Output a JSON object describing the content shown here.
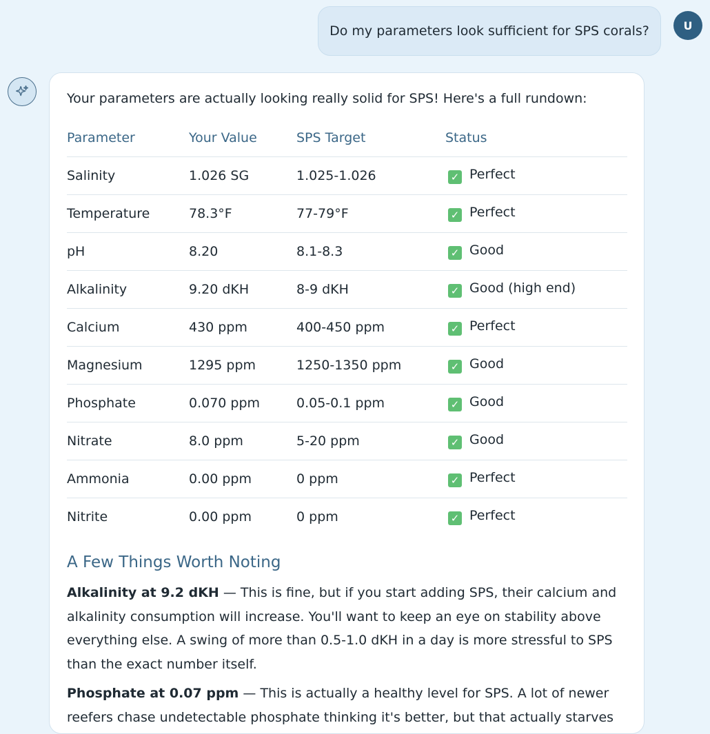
{
  "user_message": {
    "text": "Do my parameters look sufficient for SPS corals?",
    "avatar_initial": "U"
  },
  "assistant_message": {
    "avatar_icon": "sparkle-icon",
    "intro": "Your parameters are actually looking really solid for SPS! Here's a full rundown:",
    "table": {
      "headers": [
        "Parameter",
        "Your Value",
        "SPS Target",
        "Status"
      ],
      "rows": [
        {
          "parameter": "Salinity",
          "value": "1.026 SG",
          "target": "1.025-1.026",
          "status": "Perfect"
        },
        {
          "parameter": "Temperature",
          "value": "78.3°F",
          "target": "77-79°F",
          "status": "Perfect"
        },
        {
          "parameter": "pH",
          "value": "8.20",
          "target": "8.1-8.3",
          "status": "Good"
        },
        {
          "parameter": "Alkalinity",
          "value": "9.20 dKH",
          "target": "8-9 dKH",
          "status": "Good (high end)"
        },
        {
          "parameter": "Calcium",
          "value": "430 ppm",
          "target": "400-450 ppm",
          "status": "Perfect"
        },
        {
          "parameter": "Magnesium",
          "value": "1295 ppm",
          "target": "1250-1350 ppm",
          "status": "Good"
        },
        {
          "parameter": "Phosphate",
          "value": "0.070 ppm",
          "target": "0.05-0.1 ppm",
          "status": "Good"
        },
        {
          "parameter": "Nitrate",
          "value": "8.0 ppm",
          "target": "5-20 ppm",
          "status": "Good"
        },
        {
          "parameter": "Ammonia",
          "value": "0.00 ppm",
          "target": "0 ppm",
          "status": "Perfect"
        },
        {
          "parameter": "Nitrite",
          "value": "0.00 ppm",
          "target": "0 ppm",
          "status": "Perfect"
        }
      ]
    },
    "section_heading": "A Few Things Worth Noting",
    "notes": [
      {
        "bold": "Alkalinity at 9.2 dKH",
        "text": " — This is fine, but if you start adding SPS, their calcium and alkalinity consumption will increase. You'll want to keep an eye on stability above everything else. A swing of more than 0.5-1.0 dKH in a day is more stressful to SPS than the exact number itself."
      },
      {
        "bold": "Phosphate at 0.07 ppm",
        "text": " — This is actually a healthy level for SPS. A lot of newer reefers chase undetectable phosphate thinking it's better, but that actually starves corals. Right"
      }
    ]
  },
  "colors": {
    "background": "#eaf4fb",
    "user_bubble": "#dbeaf6",
    "user_avatar": "#2f5f82",
    "heading_blue": "#3b6787",
    "check_green": "#5fbf73"
  }
}
